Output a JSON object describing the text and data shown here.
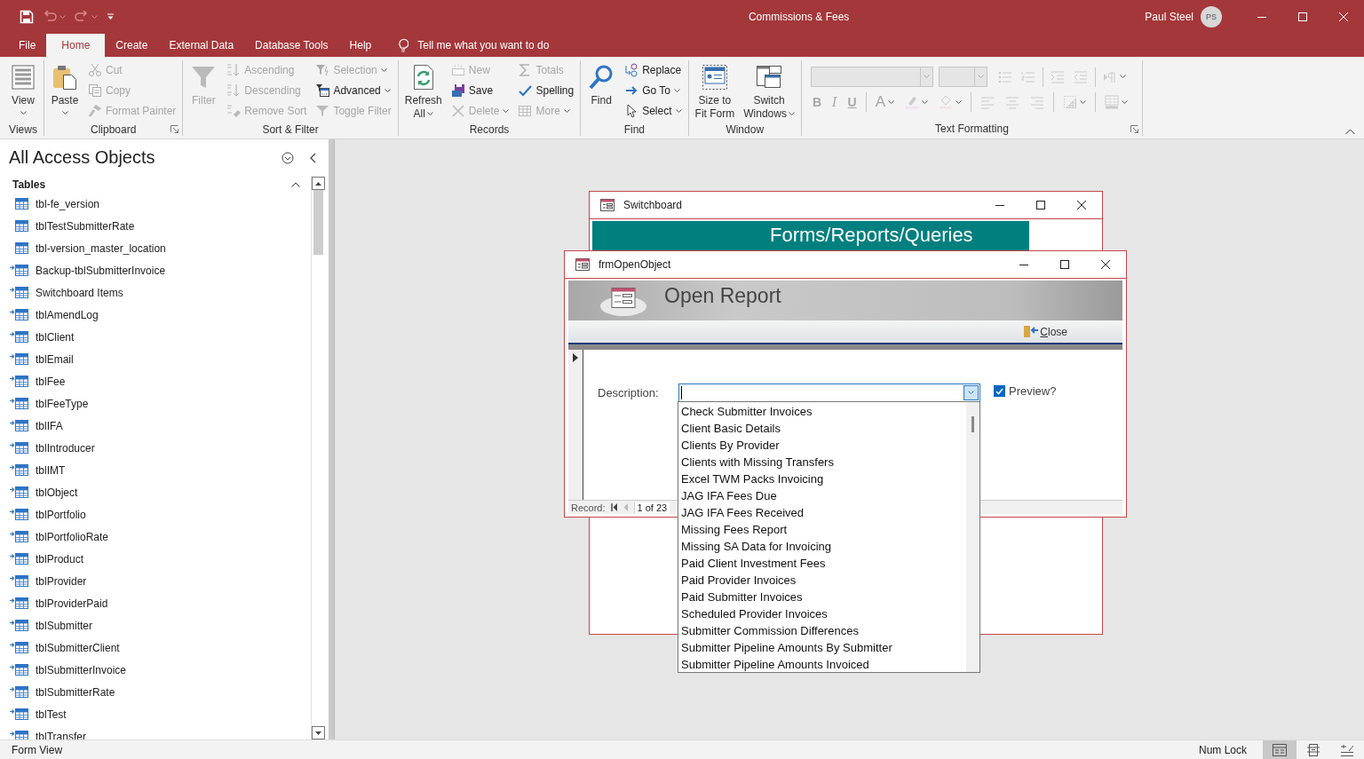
{
  "window": {
    "title": "Commissions & Fees",
    "user": "Paul Steel",
    "avatar": "PS"
  },
  "quick_access": [
    {
      "kind": "save",
      "disabled": false
    },
    {
      "kind": "undo",
      "disabled": true
    },
    {
      "kind": "redo",
      "disabled": true
    },
    {
      "kind": "customize",
      "disabled": false
    }
  ],
  "tabs": [
    {
      "label": "File",
      "selected": false
    },
    {
      "label": "Home",
      "selected": true
    },
    {
      "label": "Create",
      "selected": false
    },
    {
      "label": "External Data",
      "selected": false
    },
    {
      "label": "Database Tools",
      "selected": false
    },
    {
      "label": "Help",
      "selected": false
    }
  ],
  "tell_me": {
    "placeholder": "Tell me what you want to do"
  },
  "ribbon": {
    "groups": [
      {
        "kind": "commands",
        "label": "Views",
        "launcher": false,
        "columns": [
          [
            {
              "label": "View",
              "kind": "large",
              "disabled": false,
              "dropdown": true
            }
          ]
        ]
      },
      {
        "kind": "commands",
        "label": "Clipboard",
        "launcher": true,
        "columns": [
          [
            {
              "label": "Paste",
              "kind": "large",
              "disabled": false,
              "dropdown": true
            }
          ],
          [
            {
              "label": "Cut",
              "kind": "small",
              "disabled": true,
              "dropdown": false
            },
            {
              "label": "Copy",
              "kind": "small",
              "disabled": true,
              "dropdown": false
            },
            {
              "label": "Format Painter",
              "kind": "small",
              "disabled": true,
              "dropdown": false
            }
          ]
        ]
      },
      {
        "kind": "commands",
        "label": "Sort & Filter",
        "launcher": false,
        "columns": [
          [
            {
              "label": "Filter",
              "kind": "large",
              "disabled": true,
              "dropdown": false
            }
          ],
          [
            {
              "label": "Ascending",
              "kind": "small",
              "disabled": true,
              "dropdown": false
            },
            {
              "label": "Descending",
              "kind": "small",
              "disabled": true,
              "dropdown": false
            },
            {
              "label": "Remove Sort",
              "kind": "small",
              "disabled": true,
              "dropdown": false
            }
          ],
          [
            {
              "label": "Selection",
              "kind": "small",
              "disabled": true,
              "dropdown": true
            },
            {
              "label": "Advanced",
              "kind": "small",
              "disabled": false,
              "dropdown": true
            },
            {
              "label": "Toggle Filter",
              "kind": "small",
              "disabled": true,
              "dropdown": false
            }
          ]
        ]
      },
      {
        "kind": "commands",
        "label": "Records",
        "launcher": false,
        "columns": [
          [
            {
              "label": "Refresh\nAll",
              "kind": "large",
              "disabled": false,
              "dropdown": true
            }
          ],
          [
            {
              "label": "New",
              "kind": "small",
              "disabled": true,
              "dropdown": false
            },
            {
              "label": "Save",
              "kind": "small",
              "disabled": false,
              "dropdown": false
            },
            {
              "label": "Delete",
              "kind": "small",
              "disabled": true,
              "dropdown": true
            }
          ],
          [
            {
              "label": "Totals",
              "kind": "small",
              "disabled": true,
              "dropdown": false
            },
            {
              "label": "Spelling",
              "kind": "small",
              "disabled": false,
              "dropdown": false
            },
            {
              "label": "More",
              "kind": "small",
              "disabled": true,
              "dropdown": true
            }
          ]
        ]
      },
      {
        "kind": "commands",
        "label": "Find",
        "launcher": false,
        "columns": [
          [
            {
              "label": "Find",
              "kind": "large",
              "disabled": false,
              "dropdown": false
            }
          ],
          [
            {
              "label": "Replace",
              "kind": "small",
              "disabled": false,
              "dropdown": false
            },
            {
              "label": "Go To",
              "kind": "small",
              "disabled": false,
              "dropdown": true
            },
            {
              "label": "Select",
              "kind": "small",
              "disabled": false,
              "dropdown": true
            }
          ]
        ]
      },
      {
        "kind": "commands",
        "label": "Window",
        "launcher": false,
        "columns": [
          [
            {
              "label": "Size to\nFit Form",
              "kind": "large",
              "disabled": false,
              "dropdown": false
            }
          ],
          [
            {
              "label": "Switch\nWindows",
              "kind": "large",
              "disabled": false,
              "dropdown": true
            }
          ]
        ]
      },
      {
        "kind": "formatting",
        "label": "Text Formatting",
        "launcher": true,
        "disabled": true,
        "letters": [
          "B",
          "I",
          "U",
          "A"
        ]
      }
    ]
  },
  "navigation": {
    "title": "All Access Objects",
    "section": {
      "label": "Tables",
      "expanded": true,
      "items": [
        {
          "label": "tbl-fe_version",
          "linked": false
        },
        {
          "label": "tblTestSubmitterRate",
          "linked": false
        },
        {
          "label": "tbl-version_master_location",
          "linked": false
        },
        {
          "label": "Backup-tblSubmitterInvoice",
          "linked": true
        },
        {
          "label": "Switchboard Items",
          "linked": true
        },
        {
          "label": "tblAmendLog",
          "linked": true
        },
        {
          "label": "tblClient",
          "linked": true
        },
        {
          "label": "tblEmail",
          "linked": true
        },
        {
          "label": "tblFee",
          "linked": true
        },
        {
          "label": "tblFeeType",
          "linked": true
        },
        {
          "label": "tblIFA",
          "linked": true
        },
        {
          "label": "tblIntroducer",
          "linked": true
        },
        {
          "label": "tblIMT",
          "linked": true
        },
        {
          "label": "tblObject",
          "linked": true
        },
        {
          "label": "tblPortfolio",
          "linked": true
        },
        {
          "label": "tblPortfolioRate",
          "linked": true
        },
        {
          "label": "tblProduct",
          "linked": true
        },
        {
          "label": "tblProvider",
          "linked": true
        },
        {
          "label": "tblProviderPaid",
          "linked": true
        },
        {
          "label": "tblSubmitter",
          "linked": true
        },
        {
          "label": "tblSubmitterClient",
          "linked": true
        },
        {
          "label": "tblSubmitterInvoice",
          "linked": true
        },
        {
          "label": "tblSubmitterRate",
          "linked": true
        },
        {
          "label": "tblTest",
          "linked": true
        },
        {
          "label": "tblTransfer",
          "linked": true
        }
      ]
    }
  },
  "switchboard_window": {
    "title": "Switchboard",
    "banner": "Forms/Reports/Queries"
  },
  "open_object_window": {
    "title": "frmOpenObject",
    "heading": "Open Report",
    "close_button": "Close",
    "description_label": "Description:",
    "description_combo": {
      "expanded": true,
      "options": [
        "Check Submitter Invoices",
        "Client Basic Details",
        "Clients By Provider",
        "Clients with Missing Transfers",
        "Excel TWM Packs Invoicing",
        "JAG IFA Fees Due",
        "JAG IFA Fees Received",
        "Missing Fees Report",
        "Missing SA Data for Invoicing",
        "Paid Client Investment Fees",
        "Paid Provider Invoices",
        "Paid Submitter Invoices",
        "Scheduled Provider Invoices",
        "Submitter Commission Differences",
        "Submitter Pipeline Amounts By Submitter",
        "Submitter Pipeline Amounts Invoiced"
      ]
    },
    "preview": {
      "label": "Preview?",
      "checked": true
    },
    "record_nav": {
      "label": "Record:",
      "position": "1 of 23"
    }
  },
  "status_bar": {
    "text": "Form View",
    "indicator": "Num Lock",
    "views": [
      {
        "selected": true
      },
      {
        "selected": false
      },
      {
        "selected": false
      }
    ]
  }
}
